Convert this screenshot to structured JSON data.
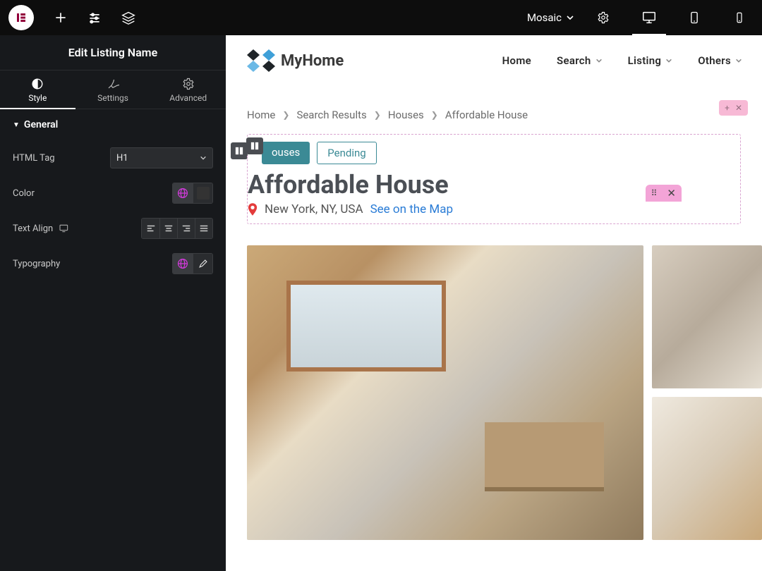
{
  "topbar": {
    "template_label": "Mosaic"
  },
  "sidebar": {
    "title": "Edit Listing Name",
    "tabs": {
      "style": "Style",
      "settings": "Settings",
      "advanced": "Advanced"
    },
    "section": "General",
    "fields": {
      "html_tag": {
        "label": "HTML Tag",
        "value": "H1"
      },
      "color": {
        "label": "Color"
      },
      "text_align": {
        "label": "Text Align"
      },
      "typography": {
        "label": "Typography"
      }
    }
  },
  "site": {
    "brand": "MyHome",
    "nav": [
      "Home",
      "Search",
      "Listing",
      "Others"
    ],
    "breadcrumbs": [
      "Home",
      "Search Results",
      "Houses",
      "Affordable House"
    ],
    "tags": {
      "houses": "ouses",
      "pending": "Pending"
    },
    "title": "Affordable House",
    "location": "New York, NY, USA",
    "map_link": "See on the Map"
  }
}
